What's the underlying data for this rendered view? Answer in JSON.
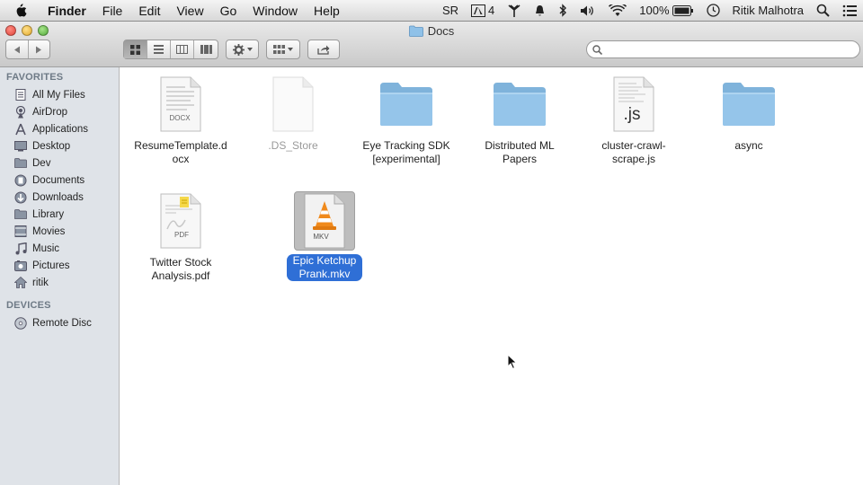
{
  "menubar": {
    "app_name": "Finder",
    "items": [
      "File",
      "Edit",
      "View",
      "Go",
      "Window",
      "Help"
    ],
    "status": {
      "input_source": "SR",
      "adobe_count": "4",
      "battery": "100%",
      "user_name": "Ritik Malhotra"
    }
  },
  "window": {
    "title": "Docs",
    "search": {
      "placeholder": "",
      "value": ""
    }
  },
  "sidebar": {
    "favorites_header": "FAVORITES",
    "favorites": [
      {
        "label": "All My Files",
        "icon": "all-files-icon"
      },
      {
        "label": "AirDrop",
        "icon": "airdrop-icon"
      },
      {
        "label": "Applications",
        "icon": "applications-icon"
      },
      {
        "label": "Desktop",
        "icon": "desktop-icon"
      },
      {
        "label": "Dev",
        "icon": "folder-icon"
      },
      {
        "label": "Documents",
        "icon": "documents-icon"
      },
      {
        "label": "Downloads",
        "icon": "downloads-icon"
      },
      {
        "label": "Library",
        "icon": "folder-icon"
      },
      {
        "label": "Movies",
        "icon": "movies-icon"
      },
      {
        "label": "Music",
        "icon": "music-icon"
      },
      {
        "label": "Pictures",
        "icon": "pictures-icon"
      },
      {
        "label": "ritik",
        "icon": "home-icon"
      }
    ],
    "devices_header": "DEVICES",
    "devices": [
      {
        "label": "Remote Disc",
        "icon": "disc-icon"
      }
    ]
  },
  "files": [
    {
      "name": "ResumeTemplate.d\nocx",
      "type": "docx",
      "badge": "DOCX"
    },
    {
      "name": ".DS_Store",
      "type": "blank"
    },
    {
      "name": "Eye Tracking SDK\n[experimental]",
      "type": "folder"
    },
    {
      "name": "Distributed ML\nPapers",
      "type": "folder"
    },
    {
      "name": "cluster-crawl-\nscrape.js",
      "type": "js",
      "badge": ".js"
    },
    {
      "name": "async",
      "type": "folder"
    },
    {
      "name": "Twitter Stock\nAnalysis.pdf",
      "type": "pdf",
      "badge": "PDF"
    },
    {
      "name": "Epic Ketchup\nPrank.mkv",
      "type": "mkv",
      "badge": "MKV",
      "selected": true
    }
  ],
  "colors": {
    "selection": "#2f6fd6",
    "folder": "#8fc1e8",
    "sidebar_bg": "#dfe3e8"
  }
}
